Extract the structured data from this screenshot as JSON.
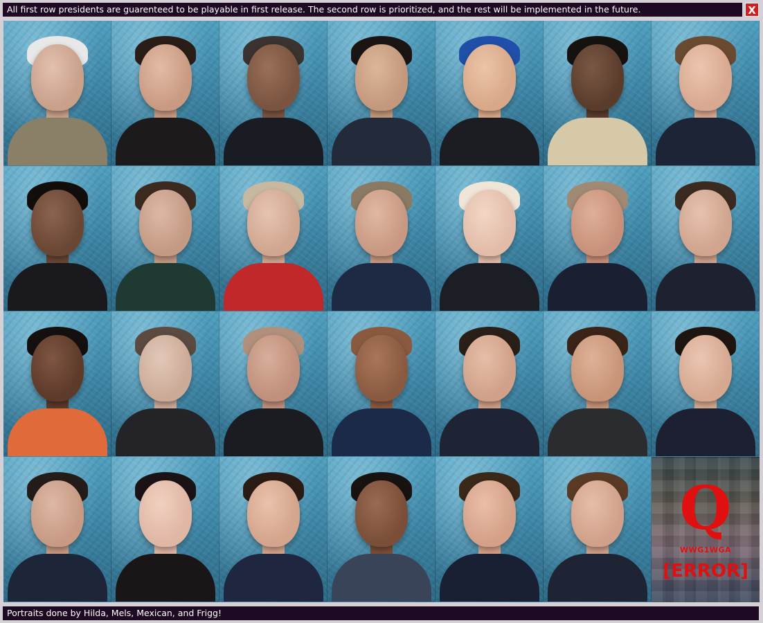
{
  "header": {
    "notice": "All first row presidents are guarenteed to be playable in first release. The second row is prioritized, and the rest will be implemented in the future.",
    "close_label": "X"
  },
  "footer": {
    "credits": "Portraits done by Hilda, Mels, Mexican, and Frigg!"
  },
  "error_tile": {
    "symbol": "Q",
    "tag": "WWG1WGA",
    "error_text": "[ERROR]"
  },
  "colors": {
    "bar_background": "#1e0a22",
    "close_button": "#d21f1f",
    "error_red": "#e01010",
    "portrait_background": "#3d86a6"
  }
}
